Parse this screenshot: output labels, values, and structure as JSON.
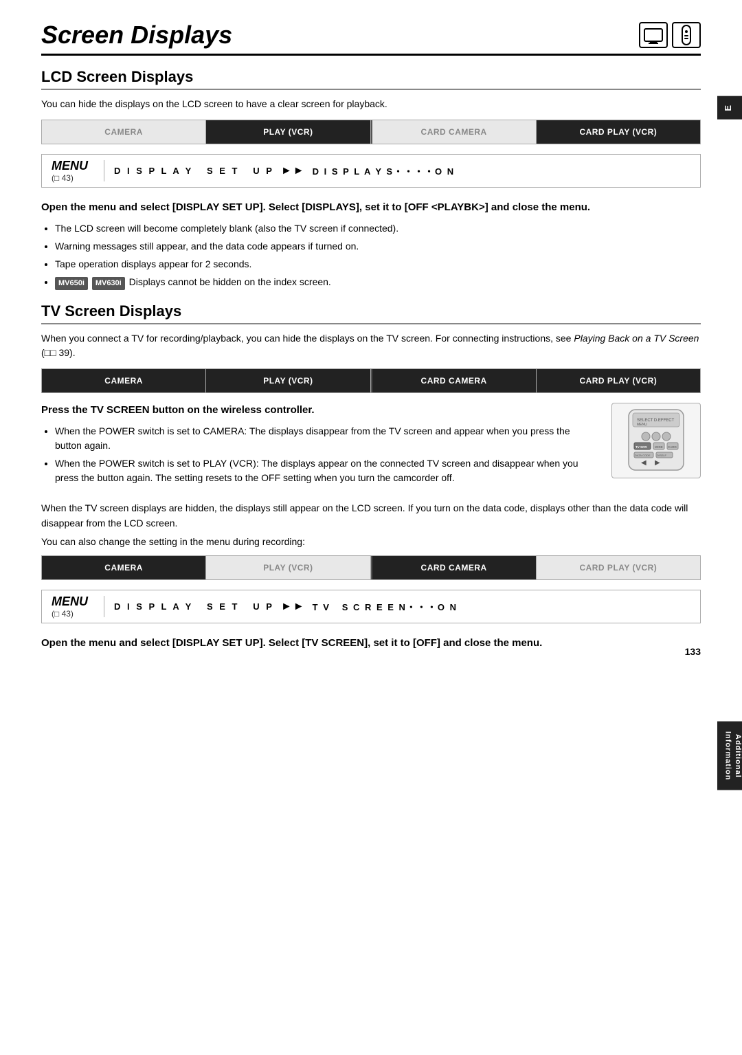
{
  "page": {
    "title": "Screen Displays",
    "page_number": "133",
    "icons": [
      "📺",
      "🎮"
    ]
  },
  "side_tabs": {
    "top": "E",
    "bottom": "Additional\nInformation"
  },
  "lcd_section": {
    "heading": "LCD Screen Displays",
    "description": "You can hide the displays on the LCD screen to have a clear screen for playback.",
    "mode_bar": {
      "cells": [
        {
          "label": "CAMERA",
          "style": "inactive"
        },
        {
          "label": "PLAY (VCR)",
          "style": "active-dark"
        },
        {
          "label": "CARD CAMERA",
          "style": "inactive"
        },
        {
          "label": "CARD PLAY (VCR)",
          "style": "active-dark"
        }
      ]
    },
    "menu": {
      "label": "MENU",
      "page": "(   43)",
      "item": "DISPLAY SET UP",
      "arrow": "▶▶",
      "value": "DISPLAYS・・・・ON"
    },
    "instruction_heading": "Open the menu and select [DISPLAY SET UP]. Select [DISPLAYS], set it to [OFF <PLAYBK>] and close the menu.",
    "bullets": [
      "The LCD screen will become completely blank (also the TV screen if connected).",
      "Warning messages still appear, and the data code appears if turned on.",
      "Tape operation displays appear for 2 seconds.",
      ""
    ],
    "badge_text_1": "MV650i",
    "badge_text_2": "MV630i",
    "badge_line": "Displays cannot be hidden on the index screen."
  },
  "tv_section": {
    "heading": "TV Screen Displays",
    "description": "When you connect a TV for recording/playback, you can hide the displays on the TV screen. For connecting instructions, see Playing Back on a TV Screen (   39).",
    "mode_bar": {
      "cells": [
        {
          "label": "CAMERA",
          "style": "active-dark"
        },
        {
          "label": "PLAY (VCR)",
          "style": "active-dark"
        },
        {
          "label": "CARD CAMERA",
          "style": "active-dark"
        },
        {
          "label": "CARD PLAY (VCR)",
          "style": "active-dark"
        }
      ]
    },
    "press_heading": "Press the TV SCREEN button on the wireless controller.",
    "bullets": [
      "When the POWER switch is set to CAMERA: The displays disappear from the TV screen and appear when you press the button again.",
      "When the POWER switch is set to PLAY (VCR): The displays appear on the connected TV screen and disappear when you press the button again. The setting resets to the OFF setting when you turn the camcorder off."
    ],
    "body_para": "When the TV screen displays are hidden, the displays still appear on the LCD screen. If you turn on the data code, displays other than the data code will disappear from the LCD screen.",
    "also_change": "You can also change the setting in the menu during recording:",
    "mode_bar2": {
      "cells": [
        {
          "label": "CAMERA",
          "style": "active-dark"
        },
        {
          "label": "PLAY (VCR)",
          "style": "inactive"
        },
        {
          "label": "CARD CAMERA",
          "style": "active-dark"
        },
        {
          "label": "CARD PLAY (VCR)",
          "style": "inactive"
        }
      ]
    },
    "menu": {
      "label": "MENU",
      "page": "(   43)",
      "item": "DISPLAY SET UP",
      "arrow": "▶▶",
      "value": "TV SCREEN・・・ON"
    },
    "final_heading": "Open the menu and select [DISPLAY SET UP]. Select [TV SCREEN], set it to [OFF] and close the menu."
  }
}
